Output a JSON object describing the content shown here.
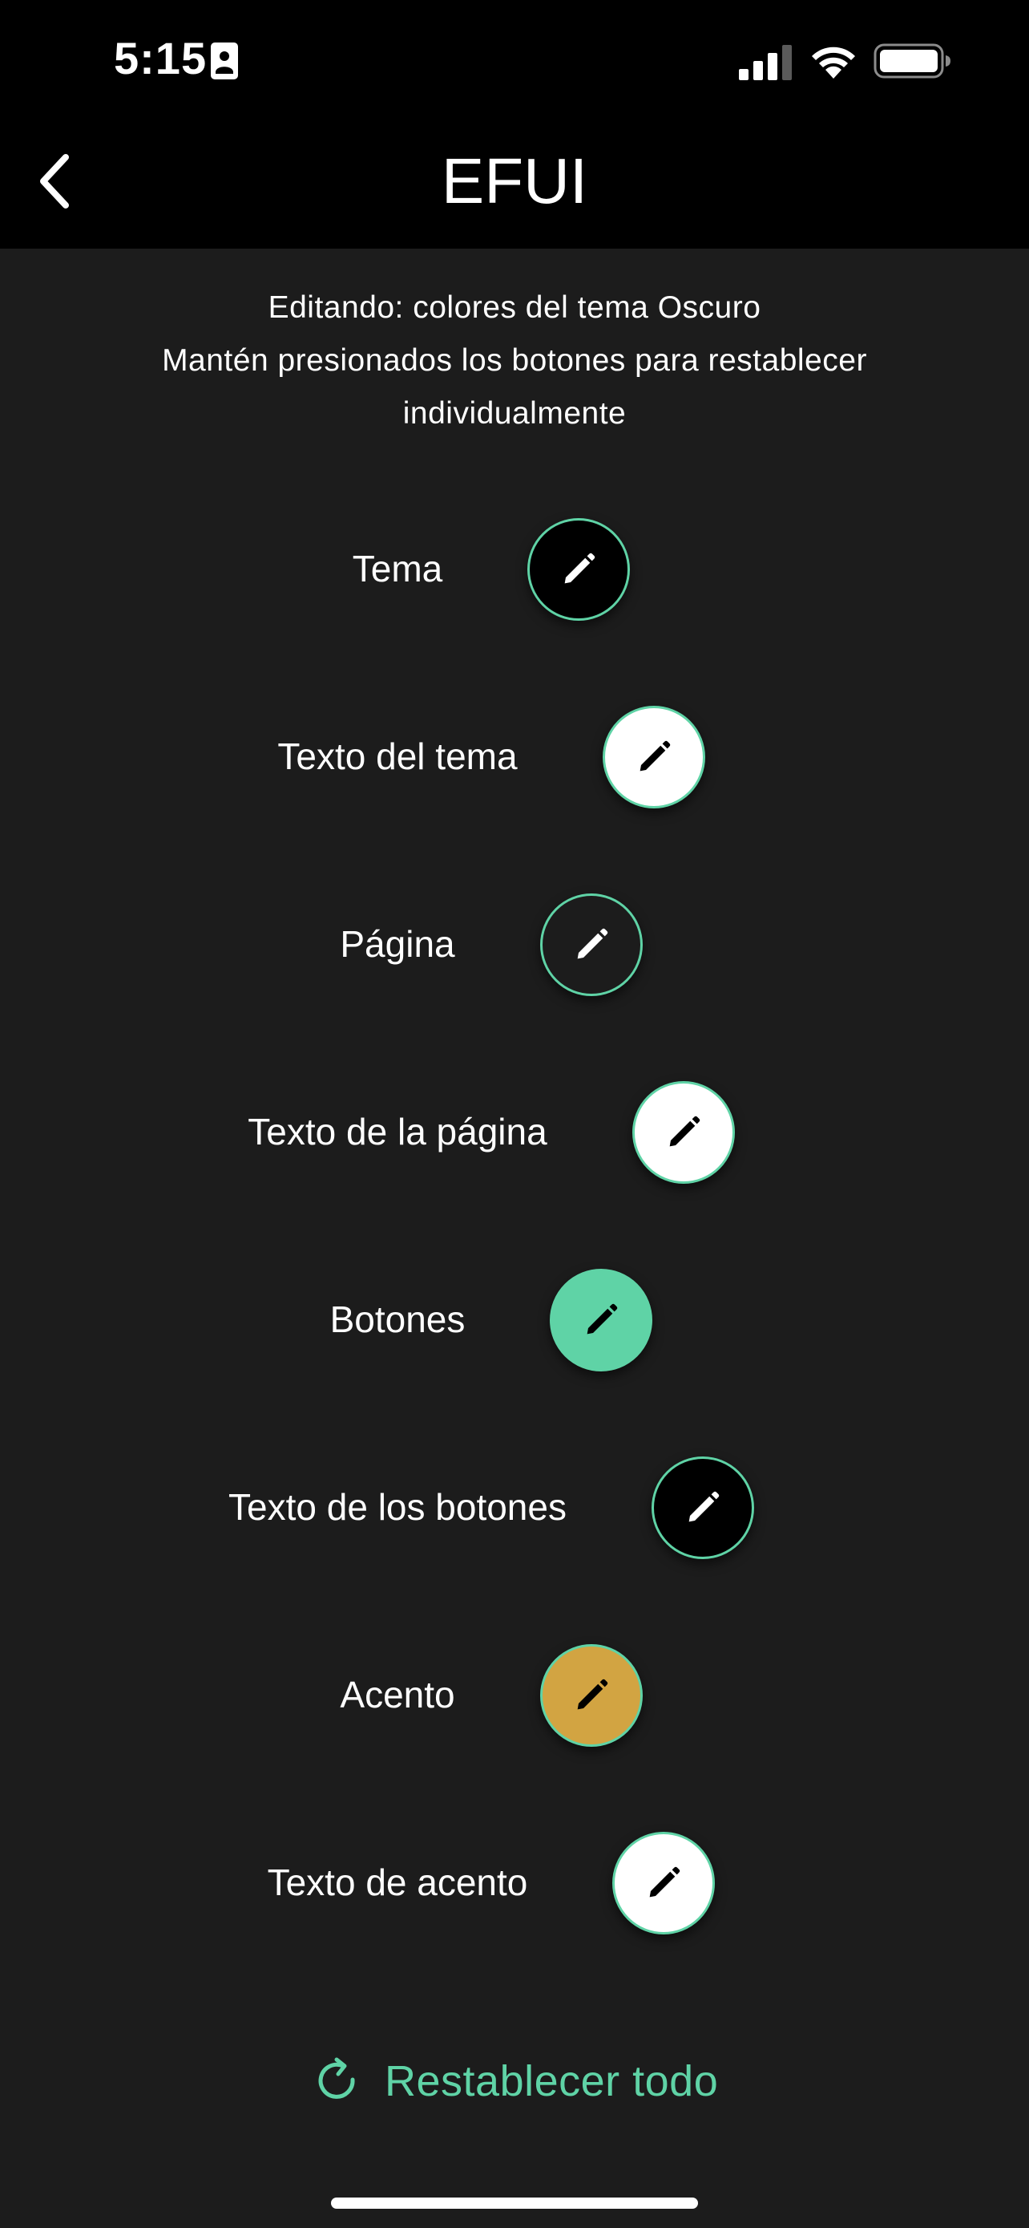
{
  "status_bar": {
    "time": "5:15",
    "icons": [
      "id-card-icon",
      "cellular-signal-icon",
      "wifi-icon",
      "battery-icon"
    ]
  },
  "nav": {
    "title": "EFUI",
    "back_icon": "chevron-left-icon"
  },
  "header": {
    "line1": "Editando: colores del tema Oscuro",
    "line2": "Mantén presionados los botones para restablecer",
    "line3": "individualmente"
  },
  "colors": {
    "accent_green": "#5fd3a6",
    "background": "#1c1c1c",
    "bar_background": "#000000"
  },
  "color_rows": [
    {
      "label": "Tema",
      "swatch_color": "#000000",
      "icon_color": "#ffffff"
    },
    {
      "label": "Texto del tema",
      "swatch_color": "#ffffff",
      "icon_color": "#000000"
    },
    {
      "label": "Página",
      "swatch_color": "#1c1c1c",
      "icon_color": "#ffffff"
    },
    {
      "label": "Texto de la página",
      "swatch_color": "#ffffff",
      "icon_color": "#000000"
    },
    {
      "label": "Botones",
      "swatch_color": "#5fd3a6",
      "icon_color": "#000000"
    },
    {
      "label": "Texto de los botones",
      "swatch_color": "#000000",
      "icon_color": "#ffffff"
    },
    {
      "label": "Acento",
      "swatch_color": "#d2a442",
      "icon_color": "#000000"
    },
    {
      "label": "Texto de acento",
      "swatch_color": "#ffffff",
      "icon_color": "#000000"
    }
  ],
  "reset": {
    "label": "Restablecer todo",
    "icon": "refresh-icon"
  }
}
